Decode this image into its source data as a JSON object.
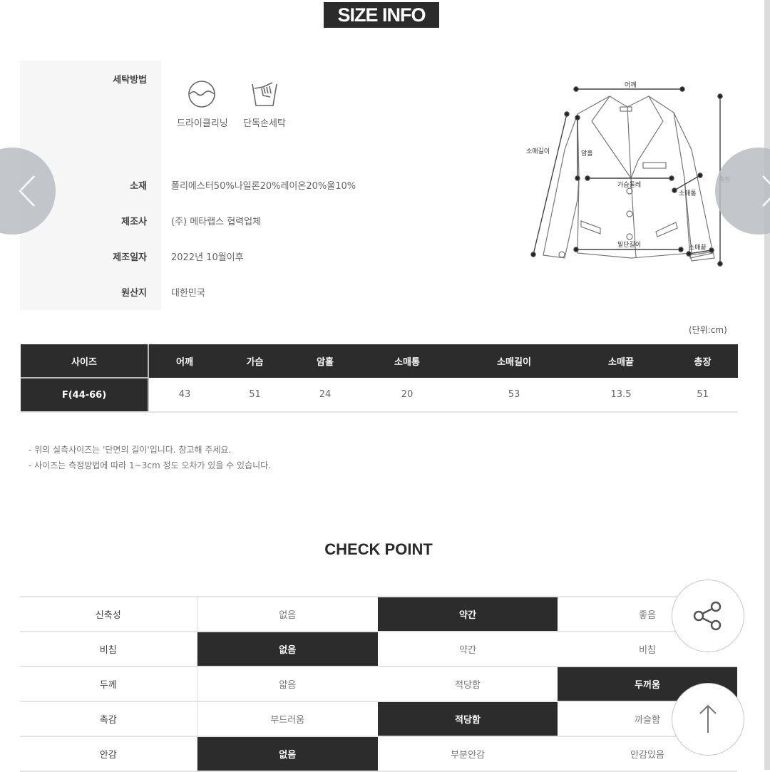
{
  "header": {
    "title": "SIZE INFO"
  },
  "info": {
    "wash_label": "세탁방법",
    "wash_methods": [
      {
        "icon": "dry-clean-icon",
        "label": "드라이클리닝"
      },
      {
        "icon": "hand-wash-icon",
        "label": "단독손세탁"
      }
    ],
    "rows": [
      {
        "label": "소재",
        "value": "폴리에스터50%나일론20%레이온20%울10%"
      },
      {
        "label": "제조사",
        "value": "(주) 메타랩스 협력업체"
      },
      {
        "label": "제조일자",
        "value": "2022년 10월이후"
      },
      {
        "label": "원산지",
        "value": "대한민국"
      }
    ]
  },
  "diagram": {
    "labels": {
      "shoulder": "어깨",
      "sleeve_length": "소매길이",
      "armhole": "암홀",
      "chest": "가슴둘레",
      "sleeve_width": "소매통",
      "hem": "밑단길이",
      "sleeve_cuff": "소매끝",
      "total_length": "총장"
    }
  },
  "carousel": {
    "prev_icon": "chevron-left-icon",
    "next_icon": "chevron-right-icon"
  },
  "size_table": {
    "unit": "(단위:cm)",
    "headers": [
      "사이즈",
      "어깨",
      "가슴",
      "암홀",
      "소매통",
      "소매길이",
      "소매끝",
      "총장"
    ],
    "rows": [
      [
        "F(44-66)",
        "43",
        "51",
        "24",
        "20",
        "53",
        "13.5",
        "51"
      ]
    ]
  },
  "notes": [
    "- 위의 실측사이즈는 '단면의 길이'입니다. 참고해 주세요.",
    "- 사이즈는 측정방법에 따라 1~3cm 정도 오차가 있을 수 있습니다."
  ],
  "check_point": {
    "title": "CHECK POINT",
    "rows": [
      {
        "label": "신축성",
        "options": [
          "없음",
          "약간",
          "좋음"
        ],
        "selected": 1
      },
      {
        "label": "비침",
        "options": [
          "없음",
          "약간",
          "비침"
        ],
        "selected": 0
      },
      {
        "label": "두께",
        "options": [
          "얇음",
          "적당함",
          "두꺼움"
        ],
        "selected": 2
      },
      {
        "label": "촉감",
        "options": [
          "부드러움",
          "적당함",
          "까슬함"
        ],
        "selected": 1
      },
      {
        "label": "안감",
        "options": [
          "없음",
          "부분안감",
          "안감있음"
        ],
        "selected": 0
      }
    ]
  },
  "floating": {
    "share_icon": "share-icon",
    "top_icon": "arrow-up-icon"
  },
  "colors": {
    "dark": "#2c2c2c",
    "panel": "#f6f6f7",
    "arrow_bg": "#b9bcc1"
  }
}
